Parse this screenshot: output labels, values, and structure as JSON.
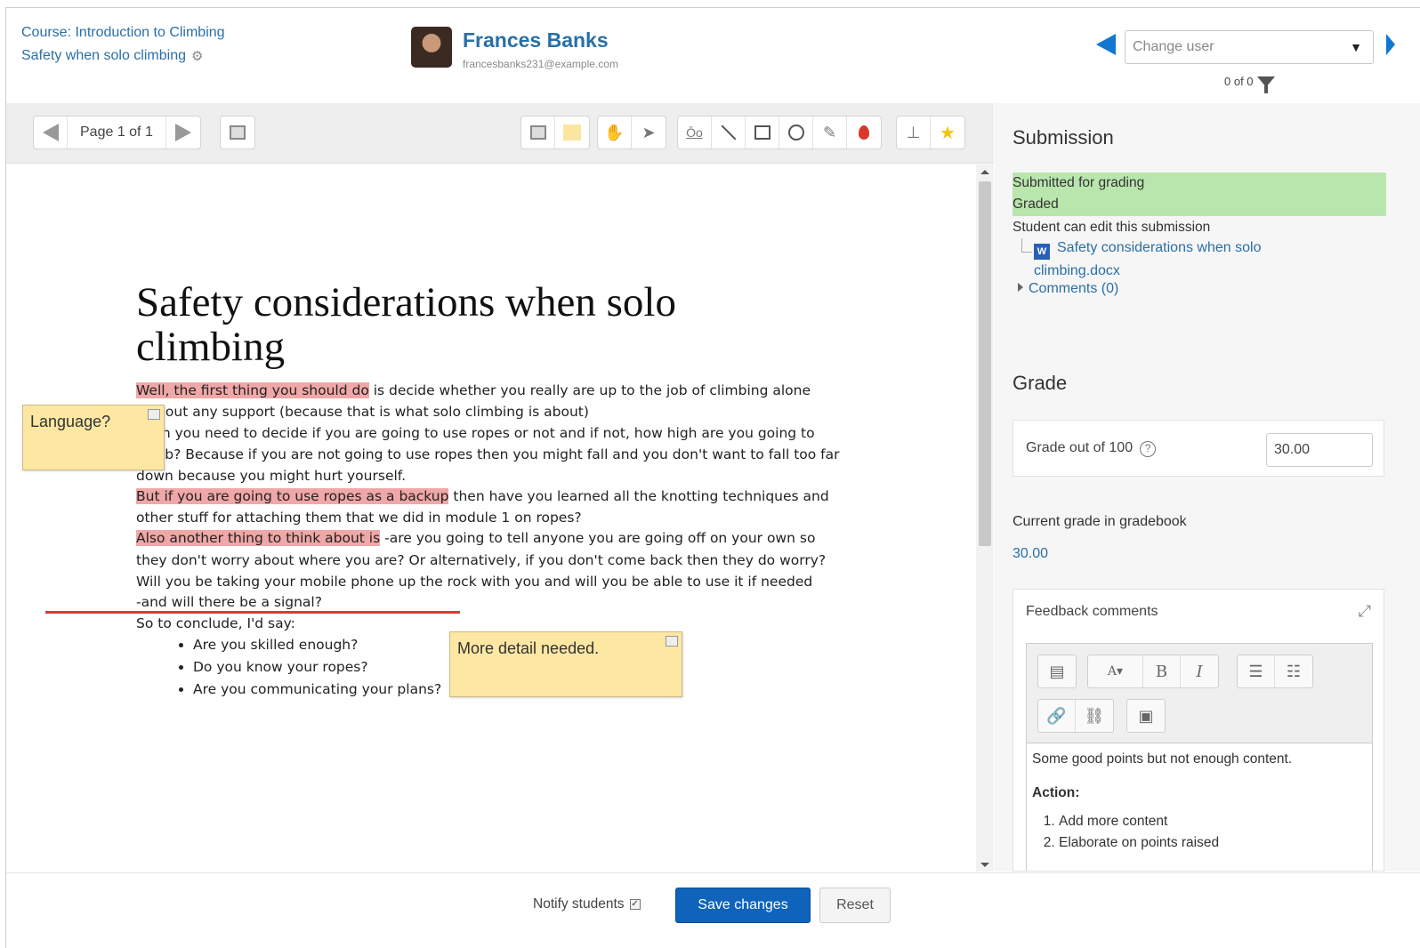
{
  "header": {
    "course_link": "Course: Introduction to Climbing",
    "assignment_link": "Safety when solo climbing",
    "user_name": "Frances Banks",
    "user_email": "francesbanks231@example.com",
    "change_user_placeholder": "Change user",
    "count": "0 of 0"
  },
  "toolbar": {
    "page_label": "Page 1 of 1",
    "icons": [
      "prev-page-icon",
      "next-page-icon",
      "search-comments-icon",
      "comment-color-icon",
      "comment-yellow-icon",
      "pan-icon",
      "select-icon",
      "comment-tool-icon",
      "line-icon",
      "rectangle-icon",
      "oval-icon",
      "pen-icon",
      "color-drop-icon",
      "stamp-icon",
      "star-stamp-icon"
    ],
    "colors": {
      "drop": "#d9372b",
      "star": "#f1c40f",
      "note": "#fde7a3"
    }
  },
  "document": {
    "title": "Safety considerations when solo climbing",
    "lines": [
      {
        "hl": "Well, the first thing you should do",
        "rest": " is decide whether you really are up to the job of climbing alone"
      },
      {
        "text": "without any support (because that is what solo climbing is about)"
      },
      {
        "text": "Then you need to decide if you are going to use ropes or not and if not, how high are you going to"
      },
      {
        "text": "climb? Because if you are not going to use ropes then you might fall and you don't want to fall too far"
      },
      {
        "text": "down because you might hurt yourself."
      },
      {
        "hl": "But if you are going to use ropes as a backup",
        "rest": " then have you learned all the knotting techniques and"
      },
      {
        "text": "other stuff for attaching them that we did in module 1 on ropes?"
      },
      {
        "hl": "Also another thing to think about is",
        "rest": " -are you going to tell anyone you are going off on your own so"
      },
      {
        "text": "they don't worry about where you are? Or alternatively, if you don't come back then they do worry?"
      },
      {
        "text": "Will you be taking your mobile phone up the rock with you and will you be able to use it if needed"
      },
      {
        "text": "-and will there be a signal?"
      },
      {
        "text": "So to conclude, I'd say:"
      }
    ],
    "bullets": [
      "Are you skilled enough?",
      "Do you know your ropes?",
      "Are you communicating your plans?"
    ],
    "notes": {
      "language": "Language?",
      "detail": "More detail needed."
    }
  },
  "sidebar": {
    "submission_heading": "Submission",
    "status_submitted": "Submitted for grading",
    "status_graded": "Graded",
    "edit_status": "Student can edit this submission",
    "file_name": "Safety considerations when solo climbing.docx",
    "comments_link": "Comments (0)",
    "grade_heading": "Grade",
    "grade_label": "Grade out of 100",
    "grade_value": "30.00",
    "gradebook_label": "Current grade in gradebook",
    "gradebook_value": "30.00",
    "feedback_title": "Feedback comments",
    "feedback_text": "Some good points but not enough content.",
    "feedback_action": "Action:",
    "feedback_items": [
      "Add more content",
      "Elaborate on points raised"
    ]
  },
  "footer": {
    "notify_label": "Notify students",
    "save_label": "Save changes",
    "reset_label": "Reset"
  }
}
